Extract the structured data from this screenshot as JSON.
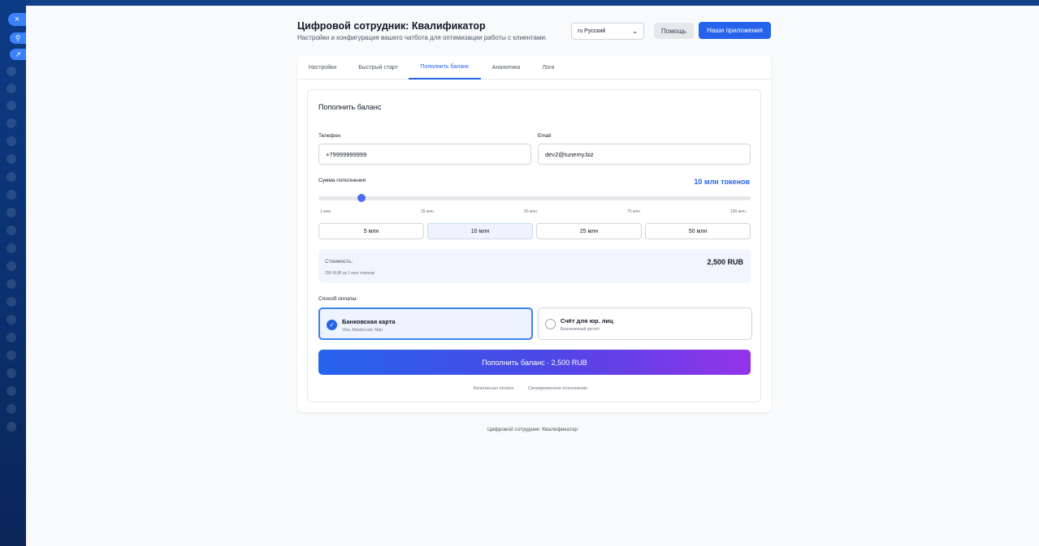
{
  "app": {
    "title": "Цифровой сотрудник: Квалификатор",
    "subtitle": "Настройки и конфигурация вашего чатбота для оптимизации работы с клиентами."
  },
  "header": {
    "language": "ru Русский",
    "help_label": "Помощь",
    "apps_label": "Наши приложения"
  },
  "tabs": [
    {
      "label": "Настройки",
      "active": false
    },
    {
      "label": "Быстрый старт",
      "active": false
    },
    {
      "label": "Пополнить баланс",
      "active": true
    },
    {
      "label": "Аналитика",
      "active": false
    },
    {
      "label": "Логи",
      "active": false
    }
  ],
  "topup": {
    "section_title": "Пополнить баланс",
    "phone_label": "Телефон",
    "phone_value": "+79999999999",
    "email_label": "Email",
    "email_value": "dev2@tunemy.biz",
    "amount_label": "Сумма пополнения",
    "tokens_display": "10 млн токенов",
    "slider": {
      "value_fraction": 0.1,
      "ticks": [
        "1 млн",
        "25 млн",
        "50 млн",
        "75 млн",
        "100 млн"
      ]
    },
    "presets": [
      {
        "label": "5 млн",
        "active": false
      },
      {
        "label": "10 млн",
        "active": true
      },
      {
        "label": "25 млн",
        "active": false
      },
      {
        "label": "50 млн",
        "active": false
      }
    ],
    "cost_label": "Стоимость:",
    "cost_rate": "250 RUB за 1 млн токенов",
    "cost_value": "2,500 RUB",
    "payment_label": "Способ оплаты:",
    "payment_methods": [
      {
        "title": "Банковская карта",
        "subtitle": "Visa, Mastercard, Мир",
        "selected": true
      },
      {
        "title": "Счёт для юр. лиц",
        "subtitle": "Безналичный расчёт",
        "selected": false
      }
    ],
    "submit_label": "Пополнить баланс · 2,500 RUB",
    "notes": [
      "Безопасная оплата",
      "Своевременное пополнение"
    ]
  },
  "footer": {
    "text": "Цифровой сотрудник: Квалификатор"
  },
  "colors": {
    "accent": "#2563eb",
    "gradient_end": "#9333ea"
  }
}
